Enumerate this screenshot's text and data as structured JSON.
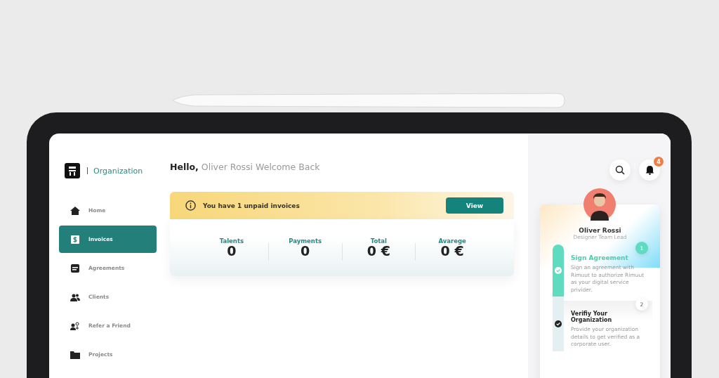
{
  "brand": {
    "label": "Organization"
  },
  "sidebar": {
    "items": [
      {
        "label": "Home",
        "selected": false
      },
      {
        "label": "Invoices",
        "selected": true
      },
      {
        "label": "Agreements",
        "selected": false
      },
      {
        "label": "Clients",
        "selected": false
      },
      {
        "label": "Refer a Friend",
        "selected": false
      },
      {
        "label": "Projects",
        "selected": false
      }
    ]
  },
  "greeting": {
    "hello": "Hello,",
    "text": "Oliver Rossi Welcome Back"
  },
  "alert": {
    "message": "You have 1 unpaid invoices",
    "button": "View"
  },
  "stats": [
    {
      "label": "Talents",
      "value": "0"
    },
    {
      "label": "Payments",
      "value": "0"
    },
    {
      "label": "Total",
      "value": "0 €"
    },
    {
      "label": "Avarege",
      "value": "0 €"
    }
  ],
  "notifications": {
    "count": "4"
  },
  "profile": {
    "name": "Oliver Rossi",
    "role": "Designer Team Lead"
  },
  "steps": [
    {
      "number": "1",
      "title": "Sign Agreement",
      "description": "Sign an agreement with Rimuut to authorize Rimuut as your digital service privider.",
      "active": true
    },
    {
      "number": "2",
      "title": "Verifiy Your Organization",
      "description": "Provide your organization details to get verified as a corporate user.",
      "active": false
    }
  ]
}
